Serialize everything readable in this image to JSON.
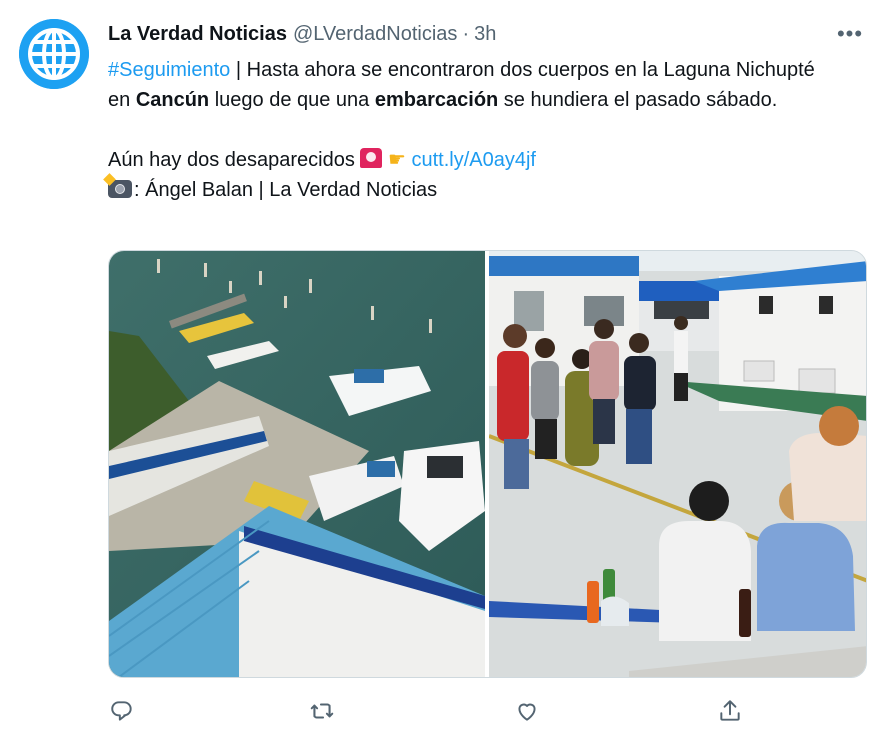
{
  "tweet": {
    "author_name": "La Verdad Noticias",
    "author_handle": "@LVerdadNoticias",
    "separator": "·",
    "time": "3h",
    "more_label": "•••",
    "line1": {
      "hashtag": "#Seguimiento",
      "t1": " | Hasta ahora se encontraron dos cuerpos en la Laguna Nichupté en ",
      "b1": "Cancún",
      "t2": " luego de que una ",
      "b2": "embarcación",
      "t3": " se hundiera el pasado sábado."
    },
    "line2": {
      "text": "Aún hay dos desaparecidos ",
      "link": "cutt.ly/A0ay4jf"
    },
    "line3": {
      "text": ": Ángel Balan |  La Verdad Noticias"
    }
  },
  "media": {
    "left_photo": "aerial-marina-boats",
    "right_photo": "people-on-dock"
  },
  "icons": {
    "reply": "reply-icon",
    "retweet": "retweet-icon",
    "like": "like-icon",
    "share": "share-icon"
  },
  "colors": {
    "accent": "#1d9bf0",
    "text": "#0f1419",
    "secondary": "#536471"
  }
}
